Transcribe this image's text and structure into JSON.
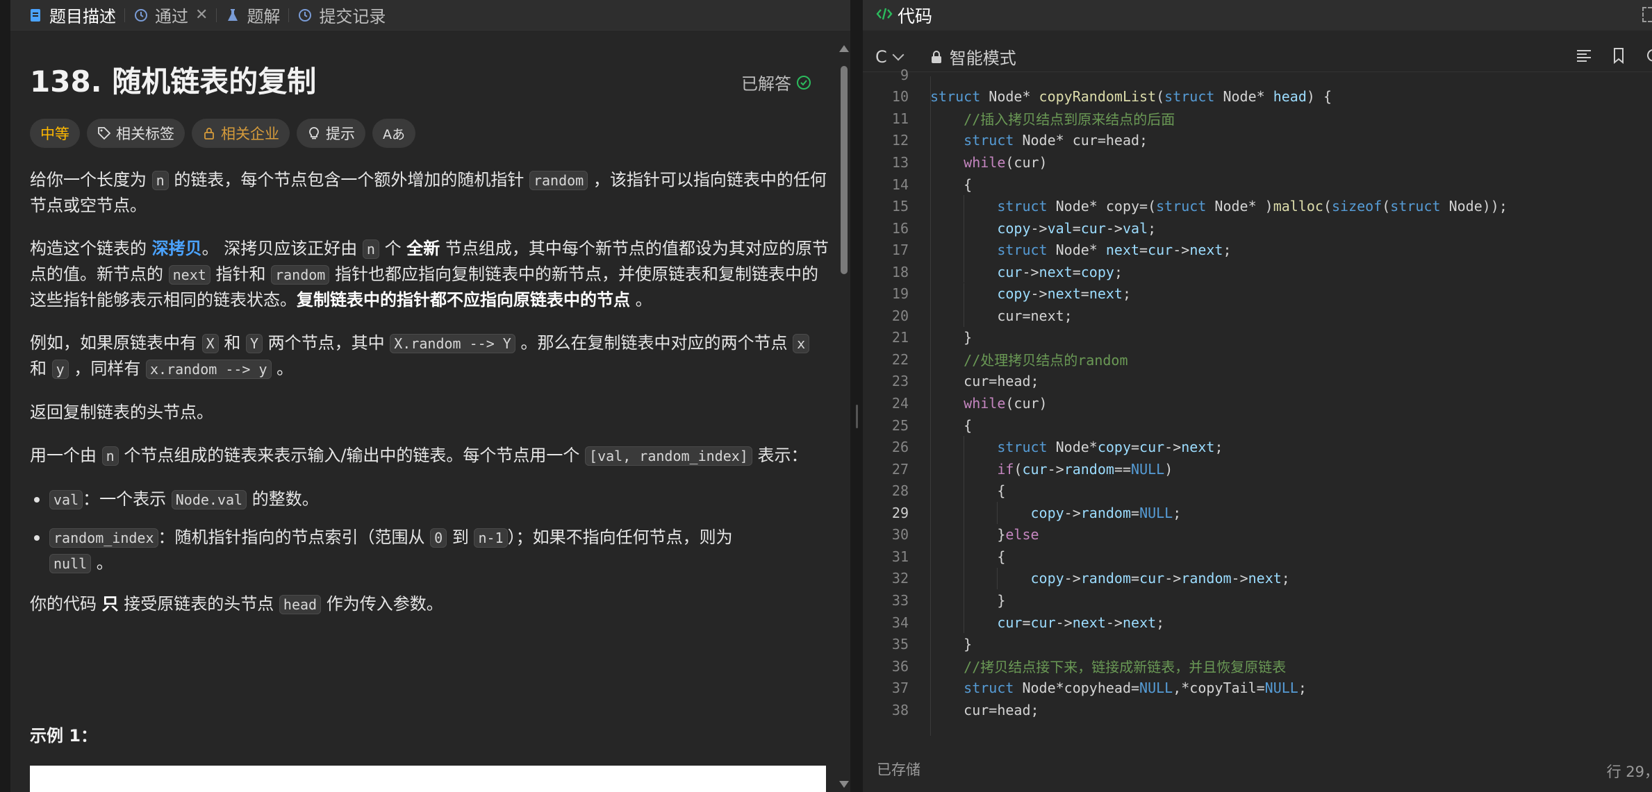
{
  "left_tabs": [
    {
      "label": "题目描述",
      "icon": "document-icon"
    },
    {
      "label": "通过",
      "icon": "history-icon"
    },
    {
      "label": "题解",
      "icon": "flask-icon"
    },
    {
      "label": "提交记录",
      "icon": "history-icon"
    }
  ],
  "problem": {
    "title": "138. 随机链表的复制",
    "status": "已解答",
    "tags": [
      "中等",
      "相关标签",
      "相关企业",
      "提示",
      "Aあ"
    ],
    "p1": {
      "a": "给你一个长度为 ",
      "code1": "n",
      "b": " 的链表，每个节点包含一个额外增加的随机指针 ",
      "code2": "random",
      "c": " ，该指针可以指向链表中的任何节点或空节点。"
    },
    "p2": {
      "a": "构造这个链表的 ",
      "link": "深拷贝",
      "b": "。 深拷贝应该正好由 ",
      "code1": "n",
      "c": " 个 ",
      "bold1": "全新",
      "d": " 节点组成，其中每个新节点的值都设为其对应的原节点的值。新节点的 ",
      "code2": "next",
      "e": " 指针和 ",
      "code3": "random",
      "f": " 指针也都应指向复制链表中的新节点，并使原链表和复制链表中的这些指针能够表示相同的链表状态。",
      "bold2": "复制链表中的指针都不应指向原链表中的节点",
      "g": " 。"
    },
    "p3": {
      "a": "例如，如果原链表中有 ",
      "code1": "X",
      "b": " 和 ",
      "code2": "Y",
      "c": " 两个节点，其中 ",
      "code3": "X.random --> Y",
      "d": " 。那么在复制链表中对应的两个节点 ",
      "code4": "x",
      "e": " 和 ",
      "code5": "y",
      "f": " ，同样有 ",
      "code6": "x.random --> y",
      "g": " 。"
    },
    "p4": "返回复制链表的头节点。",
    "p5": {
      "a": "用一个由 ",
      "code1": "n",
      "b": " 个节点组成的链表来表示输入/输出中的链表。每个节点用一个 ",
      "code2": "[val, random_index]",
      "c": " 表示："
    },
    "li1": {
      "code": "val",
      "text": "：一个表示 ",
      "code2": "Node.val",
      "text2": " 的整数。"
    },
    "li2": {
      "code": "random_index",
      "text": "：随机指针指向的节点索引（范围从 ",
      "code2": "0",
      "text2": " 到 ",
      "code3": "n-1",
      "text3": "）；如果不指向任何节点，则为 ",
      "code4": "null",
      "text4": " 。"
    },
    "p6": {
      "a": "你的代码 ",
      "bold": "只",
      "b": " 接受原链表的头节点 ",
      "code": "head",
      "c": " 作为传入参数。"
    },
    "example_title": "示例 1："
  },
  "editor": {
    "tab_title": "代码",
    "language": "C",
    "mode": "智能模式",
    "status": "已存储",
    "cursor": "行 29，",
    "current_line": 29,
    "lines": [
      {
        "n": 9,
        "code": ""
      },
      {
        "n": 10,
        "code": "struct Node* copyRandomList(struct Node* head) {"
      },
      {
        "n": 11,
        "code": "    //插入拷贝结点到原来结点的后面"
      },
      {
        "n": 12,
        "code": "    struct Node* cur=head;"
      },
      {
        "n": 13,
        "code": "    while(cur)"
      },
      {
        "n": 14,
        "code": "    {"
      },
      {
        "n": 15,
        "code": "        struct Node* copy=(struct Node* )malloc(sizeof(struct Node));"
      },
      {
        "n": 16,
        "code": "        copy->val=cur->val;"
      },
      {
        "n": 17,
        "code": "        struct Node* next=cur->next;"
      },
      {
        "n": 18,
        "code": "        cur->next=copy;"
      },
      {
        "n": 19,
        "code": "        copy->next=next;"
      },
      {
        "n": 20,
        "code": "        cur=next;"
      },
      {
        "n": 21,
        "code": "    }"
      },
      {
        "n": 22,
        "code": "    //处理拷贝结点的random"
      },
      {
        "n": 23,
        "code": "    cur=head;"
      },
      {
        "n": 24,
        "code": "    while(cur)"
      },
      {
        "n": 25,
        "code": "    {"
      },
      {
        "n": 26,
        "code": "        struct Node*copy=cur->next;"
      },
      {
        "n": 27,
        "code": "        if(cur->random==NULL)"
      },
      {
        "n": 28,
        "code": "        {"
      },
      {
        "n": 29,
        "code": "            copy->random=NULL;"
      },
      {
        "n": 30,
        "code": "        }else"
      },
      {
        "n": 31,
        "code": "        {"
      },
      {
        "n": 32,
        "code": "            copy->random=cur->random->next;"
      },
      {
        "n": 33,
        "code": "        }"
      },
      {
        "n": 34,
        "code": "        cur=cur->next->next;"
      },
      {
        "n": 35,
        "code": "    }"
      },
      {
        "n": 36,
        "code": "    //拷贝结点接下来，链接成新链表，并且恢复原链表"
      },
      {
        "n": 37,
        "code": "    struct Node*copyhead=NULL,*copyTail=NULL;"
      },
      {
        "n": 38,
        "code": "    cur=head;"
      }
    ]
  },
  "colors": {
    "keyword": "#569cd6",
    "function": "#dcdcaa",
    "variable": "#9cdcfe",
    "comment": "#6a9955",
    "control": "#c586c0",
    "difficulty": "#ffb800",
    "link": "#4ba3ff",
    "solved": "#2cbb5d"
  }
}
